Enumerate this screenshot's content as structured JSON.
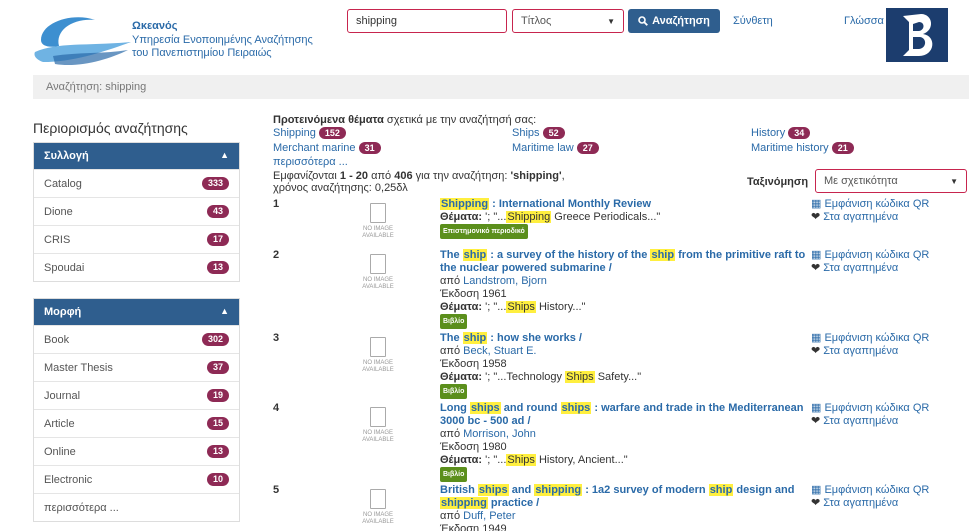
{
  "header": {
    "site_name": "Ωκεανός",
    "site_sub1": "Υπηρεσία Ενοποιημένης Αναζήτησης",
    "site_sub2": "του Πανεπιστημίου Πειραιώς",
    "search_value": "shipping",
    "field_select": "Τίτλος",
    "search_button": "Αναζήτηση",
    "nav_synthesis": "Σύνθετη",
    "nav_language": "Γλώσσα"
  },
  "breadcrumb": "Αναζήτηση: shipping",
  "sidebar": {
    "title": "Περιορισμός αναζήτησης",
    "facets": [
      {
        "title": "Συλλογή",
        "items": [
          {
            "label": "Catalog",
            "count": "333"
          },
          {
            "label": "Dione",
            "count": "43"
          },
          {
            "label": "CRIS",
            "count": "17"
          },
          {
            "label": "Spoudai",
            "count": "13"
          }
        ]
      },
      {
        "title": "Μορφή",
        "items": [
          {
            "label": "Book",
            "count": "302"
          },
          {
            "label": "Master Thesis",
            "count": "37"
          },
          {
            "label": "Journal",
            "count": "19"
          },
          {
            "label": "Article",
            "count": "15"
          },
          {
            "label": "Online",
            "count": "13"
          },
          {
            "label": "Electronic",
            "count": "10"
          }
        ],
        "more": "περισσότερα ..."
      }
    ]
  },
  "suggestions": {
    "head_bold": "Προτεινόμενα θέματα",
    "head_rest": " σχετικά με την αναζήτησή σας:",
    "topics": [
      {
        "label": "Shipping",
        "count": "152"
      },
      {
        "label": "Ships",
        "count": "52"
      },
      {
        "label": "History",
        "count": "34"
      },
      {
        "label": "Merchant marine",
        "count": "31"
      },
      {
        "label": "Maritime law",
        "count": "27"
      },
      {
        "label": "Maritime history",
        "count": "21"
      }
    ],
    "more": "περισσότερα ..."
  },
  "stats": {
    "prefix": "Εμφανίζονται ",
    "range": "1 - 20",
    "mid": " από ",
    "total": "406",
    "mid2": " για την αναζήτηση: ",
    "query": "'shipping'",
    "suffix": ",",
    "time": "χρόνος αναζήτησης: 0,25δλ"
  },
  "sort": {
    "label": "Ταξινόμηση",
    "value": "Με σχετικότητα"
  },
  "no_image": [
    "NO IMAGE",
    "AVAILABLE"
  ],
  "actions": {
    "qr": "Εμφάνιση κώδικα QR",
    "fav": "Στα αγαπημένα"
  },
  "results": [
    {
      "num": "1",
      "t1_hl": "Shipping",
      "t1_rest": " : International Monthly Review",
      "subj_label": "Θέματα:",
      "subj_pre": " '; \"...",
      "subj_hl": "Shipping",
      "subj_post": " Greece Periodicals...\"",
      "badge": "Επιστημονικό περιοδικό"
    },
    {
      "num": "2",
      "t_pre": "The ",
      "t_hl": "ship",
      "t_mid": " : a survey of the history of the ",
      "t_hl2": "ship",
      "t_post": " from the primitive raft to the nuclear powered submarine /",
      "by_label": "από ",
      "author": "Landstrom, Bjorn",
      "edition": "Έκδοση 1961",
      "subj_label": "Θέματα:",
      "subj_pre": " '; \"...",
      "subj_hl": "Ships",
      "subj_post": " History...\"",
      "badge": "Βιβλίο"
    },
    {
      "num": "3",
      "t_pre": "The ",
      "t_hl": "ship",
      "t_post": " : how she works /",
      "by_label": "από ",
      "author": "Beck, Stuart E.",
      "edition": "Έκδοση 1958",
      "subj_label": "Θέματα:",
      "subj_pre": " '; \"...Technology ",
      "subj_hl": "Ships",
      "subj_post": " Safety...\"",
      "badge": "Βιβλίο"
    },
    {
      "num": "4",
      "t_pre": "Long ",
      "t_hl": "ships",
      "t_mid": " and round ",
      "t_hl2": "ships",
      "t_post": " : warfare and trade in the Mediterranean 3000 bc - 500 ad /",
      "by_label": "από ",
      "author": "Morrison, John",
      "edition": "Έκδοση 1980",
      "subj_label": "Θέματα:",
      "subj_pre": " '; \"...",
      "subj_hl": "Ships",
      "subj_post": " History, Ancient...\"",
      "badge": "Βιβλίο"
    },
    {
      "num": "5",
      "t_pre": "British ",
      "t_hl": "ships",
      "t_mid": " and ",
      "t_hl2": "shipping",
      "t_mid2": " : 1a2 survey of modern ",
      "t_hl3": "ship",
      "t_post2": " design and ",
      "t_hl4": "shipping",
      "t_post": " practice /",
      "by_label": "από ",
      "author": "Duff, Peter",
      "edition": "Έκδοση 1949"
    }
  ]
}
